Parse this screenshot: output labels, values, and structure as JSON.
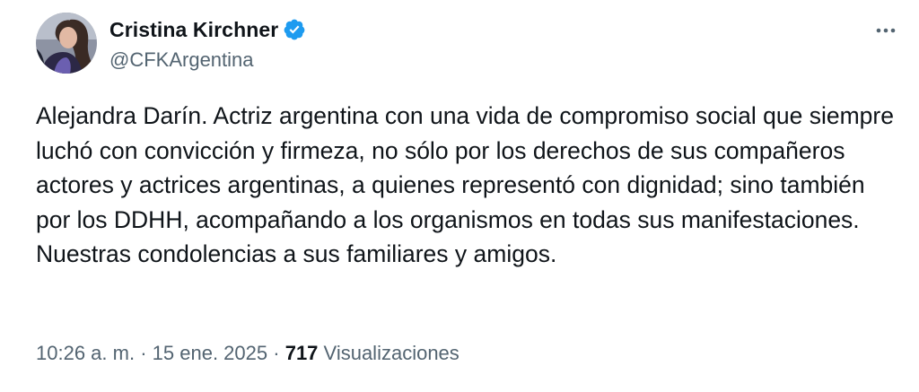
{
  "author": {
    "display_name": "Cristina Kirchner",
    "handle": "@CFKArgentina",
    "verified": true,
    "verified_color": "#1d9bf0"
  },
  "icons": {
    "verified": "verified-badge-icon",
    "more": "more-horizontal-icon"
  },
  "tweet": {
    "text": "Alejandra Darín. Actriz argentina con una vida de compromiso social que siempre luchó con convicción y firmeza, no sólo por los derechos de sus compañeros actores y actrices argentinas, a quienes representó con dignidad; sino también por los DDHH, acompañando a los organismos en todas sus manifestaciones. Nuestras condolencias a sus familiares y amigos.",
    "time": "10:26 a. m.",
    "separator": "·",
    "date": "15 ene. 2025",
    "views_count": "717",
    "views_label": "Visualizaciones"
  },
  "colors": {
    "text_primary": "#0f1419",
    "text_secondary": "#536471"
  }
}
